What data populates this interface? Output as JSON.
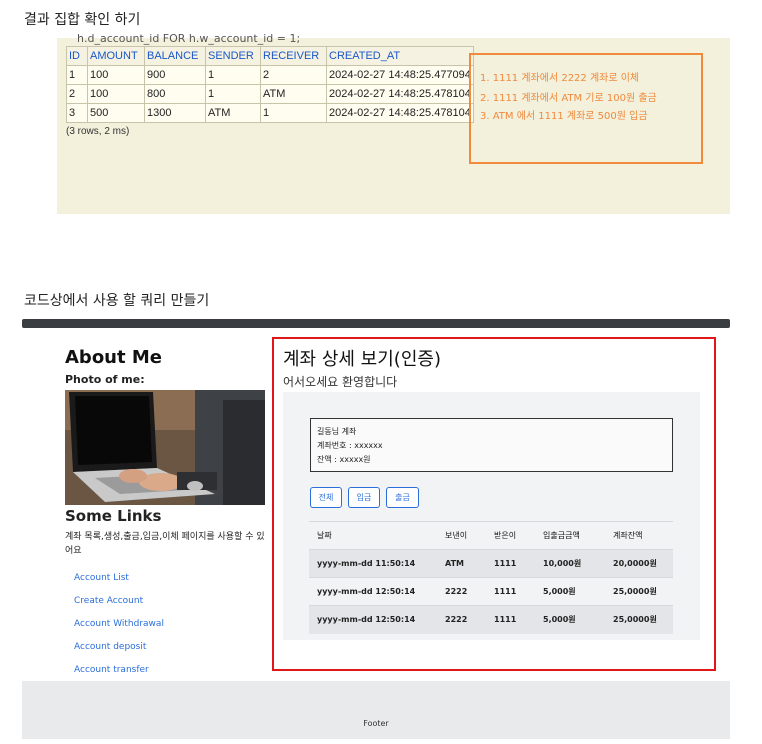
{
  "section1": {
    "title": "결과 집합 확인 하기"
  },
  "console": {
    "cut_text": "h.d_account_id   FOR h.w_account_id  = 1;",
    "columns": [
      "ID",
      "AMOUNT",
      "BALANCE",
      "SENDER",
      "RECEIVER",
      "CREATED_AT"
    ],
    "rows": [
      [
        "1",
        "100",
        "900",
        "1",
        "2",
        "2024-02-27 14:48:25.477094"
      ],
      [
        "2",
        "100",
        "800",
        "1",
        "ATM",
        "2024-02-27 14:48:25.478104"
      ],
      [
        "3",
        "500",
        "1300",
        "ATM",
        "1",
        "2024-02-27 14:48:25.478104"
      ]
    ],
    "rows_note": "(3 rows, 2 ms)",
    "notes": [
      "1. 1111 계좌에서 2222 계좌로 이체",
      "2. 1111 계좌에서 ATM 기로 100원 출금",
      "3. ATM 에서 1111 계좌로 500원 입금"
    ]
  },
  "section2": {
    "title": "코드상에서 사용 할 쿼리 만들기"
  },
  "sidebar": {
    "about_title": "About Me",
    "photo_label": "Photo of me:",
    "links_title": "Some Links",
    "links_desc": "계좌 목록,생성,출금,입금,이체 페이지를 사용할 수 있어요",
    "links": [
      "Account List",
      "Create Account",
      "Account Withdrawal",
      "Account deposit",
      "Account transfer"
    ]
  },
  "detail": {
    "title": "계좌 상세 보기(인증)",
    "welcome": "어서오세요 환영합니다",
    "account": {
      "owner": "길동님 계좌",
      "number": "계좌번호 : xxxxxx",
      "balance": "잔액 : xxxxx원"
    },
    "buttons": [
      "전체",
      "입금",
      "출금"
    ],
    "table": {
      "headers": [
        "날짜",
        "보낸이",
        "받은이",
        "입출금금액",
        "계좌잔액"
      ],
      "rows": [
        [
          "yyyy-mm-dd 11:50:14",
          "ATM",
          "1111",
          "10,000원",
          "20,0000원"
        ],
        [
          "yyyy-mm-dd 12:50:14",
          "2222",
          "1111",
          "5,000원",
          "25,0000원"
        ],
        [
          "yyyy-mm-dd 12:50:14",
          "2222",
          "1111",
          "5,000원",
          "25,0000원"
        ]
      ]
    }
  },
  "footer": {
    "text": "Footer"
  },
  "colors": {
    "note_orange": "#f08a3c",
    "highlight_red": "#e0161b",
    "link_blue": "#2a6fdb",
    "console_bg": "#f3f0dc"
  }
}
